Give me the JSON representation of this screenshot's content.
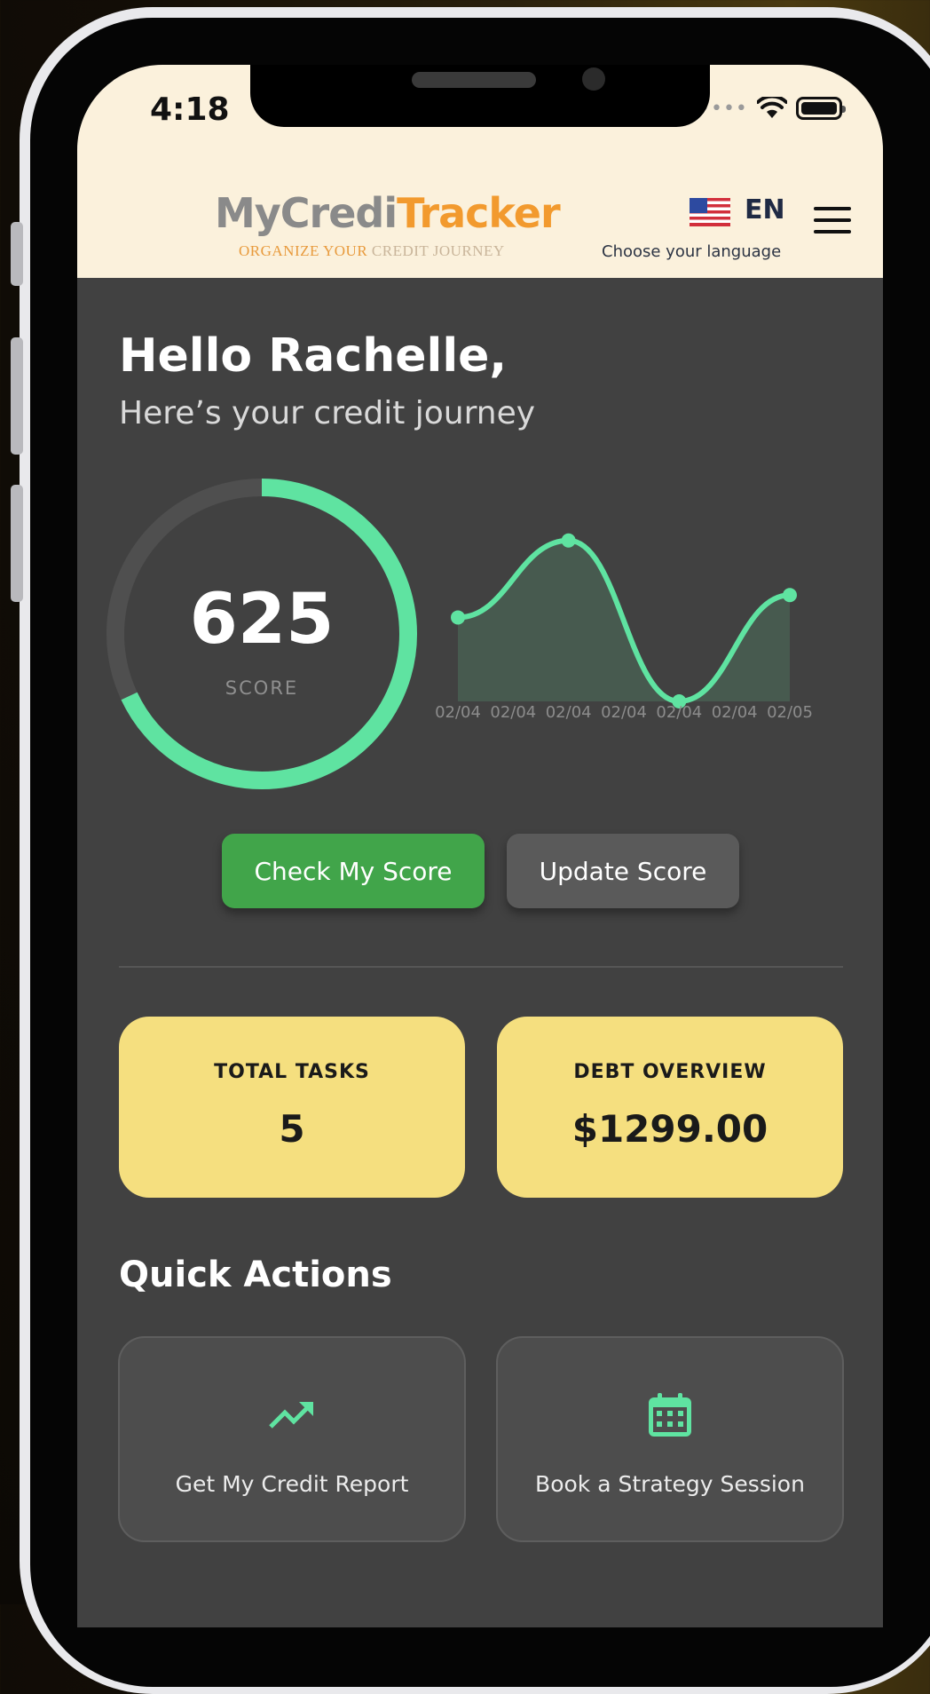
{
  "status_bar": {
    "time": "4:18"
  },
  "header": {
    "logo_part1": "MyCredi",
    "logo_part2": "Tracker",
    "tagline_part1": "ORGANIZE YOUR",
    "tagline_part2": " CREDIT JOURNEY",
    "language_code": "EN",
    "language_hint": "Choose your language"
  },
  "greeting": {
    "title": "Hello Rachelle,",
    "subtitle": "Here’s your credit journey"
  },
  "score": {
    "value": "625",
    "label": "SCORE",
    "gauge_fraction": 0.68
  },
  "chart_data": {
    "type": "line",
    "categories": [
      "02/04",
      "02/04",
      "02/04",
      "02/04",
      "02/04",
      "02/04",
      "02/05"
    ],
    "points": [
      {
        "x": 0,
        "y": 625
      },
      {
        "x": 2,
        "y": 680
      },
      {
        "x": 4,
        "y": 565
      },
      {
        "x": 6,
        "y": 641
      }
    ],
    "ylim": [
      565,
      690
    ],
    "line_color": "#5fe3a1",
    "fill_color": "#475a4f"
  },
  "buttons": {
    "check": "Check My Score",
    "update": "Update Score"
  },
  "stats": {
    "tasks_title": "TOTAL TASKS",
    "tasks_value": "5",
    "debt_title": "DEBT OVERVIEW",
    "debt_value": "$1299.00"
  },
  "quick_actions": {
    "title": "Quick Actions",
    "items": [
      {
        "label": "Get My Credit Report",
        "icon": "trending-up-icon"
      },
      {
        "label": "Book a Strategy Session",
        "icon": "calendar-icon"
      }
    ]
  },
  "colors": {
    "accent": "#5fe3a1",
    "primary_button": "#41a54a",
    "card": "#f5df7f",
    "background": "#414141",
    "header": "#fbf1dc"
  }
}
